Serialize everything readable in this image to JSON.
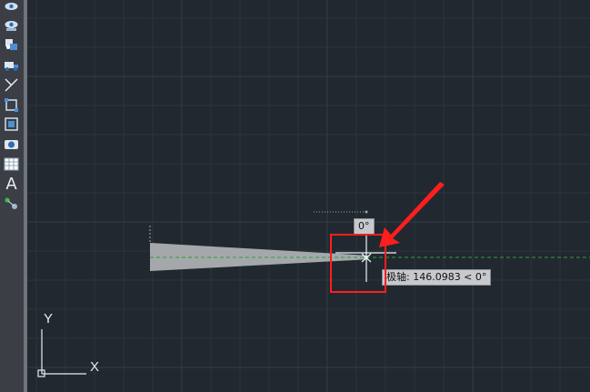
{
  "toolbar": {
    "tools": [
      {
        "icon": "eye-icon"
      },
      {
        "icon": "eye-cloud-icon"
      },
      {
        "icon": "block-insert-icon"
      },
      {
        "icon": "truck-icon"
      },
      {
        "icon": "line-icon"
      },
      {
        "icon": "region-select-icon"
      },
      {
        "icon": "boundary-icon"
      },
      {
        "icon": "camera-icon"
      },
      {
        "icon": "table-icon"
      },
      {
        "icon": "text-icon",
        "glyph": "A"
      },
      {
        "icon": "node-icon"
      }
    ]
  },
  "drawing": {
    "angle_tooltip": "0°",
    "polar_tooltip": "极轴: 146.0983 < 0°",
    "ucs": {
      "y_label": "Y",
      "x_label": "X"
    }
  },
  "colors": {
    "background": "#212830",
    "polar_tracking": "#2e9e3a",
    "highlight": "#ff1e1e"
  }
}
